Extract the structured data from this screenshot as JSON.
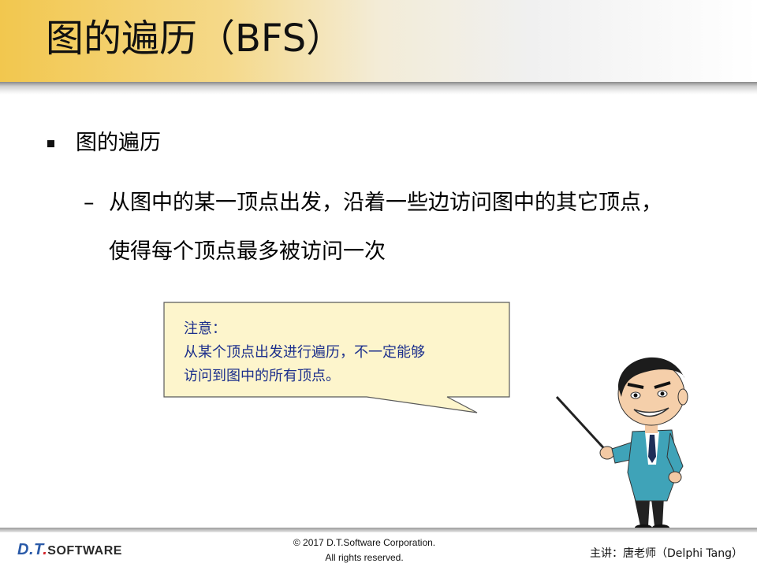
{
  "header": {
    "title": "图的遍历（BFS）"
  },
  "content": {
    "bullet1": "图的遍历",
    "dash": "–",
    "sub_line1": "从图中的某一顶点出发，沿着一些边访问图中的其它顶点，",
    "sub_line2": "使得每个顶点最多被访问一次"
  },
  "callout": {
    "lines": [
      "注意：",
      "从某个顶点出发进行遍历，不一定能够",
      "访问到图中的所有顶点。"
    ]
  },
  "footer": {
    "logo_dt": "D.T",
    "logo_dot": ".",
    "logo_software": "SOFTWARE",
    "copyright_line1": "© 2017 D.T.Software Corporation.",
    "copyright_line2": "All rights reserved.",
    "lecturer": "主讲：唐老师（Delphi Tang）"
  },
  "colors": {
    "header_gold": "#f2c74e",
    "callout_fill": "#fdf5cc",
    "callout_text": "#1c2f8c",
    "logo_blue": "#2a5aa8",
    "logo_red": "#d4232a"
  },
  "icons": {
    "bullet": "square-bullet-icon",
    "teacher": "teacher-with-pointer-illustration"
  }
}
